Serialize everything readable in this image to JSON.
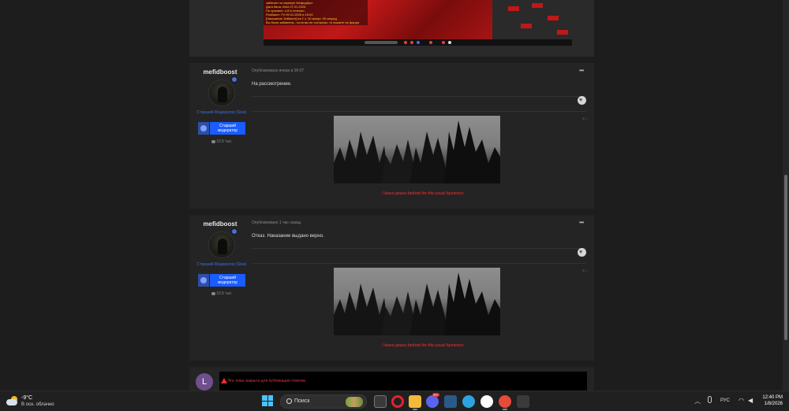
{
  "screenshot": {
    "chat_lines": [
      "забанил на сервере Мефидбуст",
      "Дата бана: Wed 07.01.2026",
      "По причине: 4.8 в течении",
      "Разбанит: Fri 09.01.2026 в 15:00",
      "[Наказание Забанен] на 2 ч. 00 минут, 00 секунд",
      "Вы были забанены - если вы не согласны, то пишите на форум"
    ]
  },
  "posts": [
    {
      "author": "mefidboost",
      "role": "Старший Модератор (Skat)",
      "rank": "Старший модератор",
      "reputation": "15.5 тыс",
      "date": "Опубликовано вчера в 06:07",
      "body": "На рассмотрении.",
      "signature": "I leave peace behind for the usual hysterics",
      "menu": "•••"
    },
    {
      "author": "mefidboost",
      "role": "Старший Модератор (Skat)",
      "rank": "Старший модератор",
      "reputation": "15.5 тыс",
      "date": "Опубликовано 1 час назад.",
      "body": "Отказ. Наказание выдано верно.",
      "signature": "I leave peace behind for the usual hysterics",
      "menu": "•••"
    }
  ],
  "closed_notice": {
    "avatar_letter": "L",
    "text": "Эта тема закрыта для публикации ответов."
  },
  "taskbar": {
    "temperature": "-9°C",
    "condition": "В осн. облачно",
    "search_label": "Поиск",
    "discord_badge": "99+",
    "language": "РУС",
    "time": "12:40 PM",
    "date": "1/8/2026",
    "icons": [
      "file-explorer-icon",
      "opera-icon",
      "yandex-music-icon",
      "discord-icon",
      "chat-icon",
      "telegram-icon",
      "yandex-icon",
      "yandex-browser-icon",
      "minecraft-icon",
      "launcher-icon"
    ]
  },
  "colors": {
    "accent_blue": "#1a5cff",
    "signature_red": "#cc2a2a",
    "warning_red": "#e53030",
    "avatar_purple": "#6f4f8e"
  }
}
